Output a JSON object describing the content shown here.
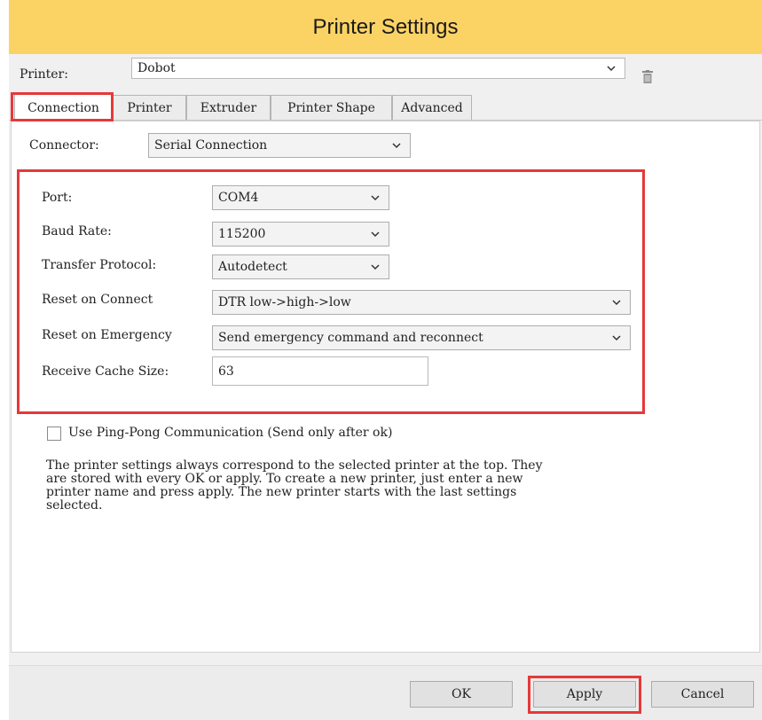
{
  "window": {
    "title": "Printer Settings"
  },
  "printer_row": {
    "label": "Printer:",
    "value": "Dobot",
    "delete_icon": "trash-icon"
  },
  "tabs": [
    {
      "label": "Connection",
      "active": true
    },
    {
      "label": "Printer",
      "active": false
    },
    {
      "label": "Extruder",
      "active": false
    },
    {
      "label": "Printer Shape",
      "active": false
    },
    {
      "label": "Advanced",
      "active": false
    }
  ],
  "connection": {
    "connector_label": "Connector:",
    "connector_value": "Serial Connection",
    "fields": {
      "port": {
        "label": "Port:",
        "value": "COM4"
      },
      "baud_rate": {
        "label": "Baud Rate:",
        "value": "115200"
      },
      "transfer_protocol": {
        "label": "Transfer Protocol:",
        "value": "Autodetect"
      },
      "reset_on_connect": {
        "label": "Reset on Connect",
        "value": "DTR low->high->low"
      },
      "reset_on_emergency": {
        "label": "Reset on Emergency",
        "value": "Send emergency command and reconnect"
      },
      "receive_cache_size": {
        "label": "Receive Cache Size:",
        "value": "63"
      }
    },
    "ping_pong": {
      "label": "Use Ping-Pong Communication (Send only after ok)",
      "checked": false
    },
    "help_lines": [
      "The printer settings always correspond to the selected printer at the top. They",
      "are stored with every OK or apply. To create a new printer, just enter a new",
      "printer name and press apply. The new printer starts with the last settings",
      "selected."
    ]
  },
  "buttons": {
    "ok": "OK",
    "apply": "Apply",
    "cancel": "Cancel"
  },
  "colors": {
    "title_bar": "#fbd365",
    "highlight": "#e5393a",
    "window_background": "#f0f0f0"
  }
}
